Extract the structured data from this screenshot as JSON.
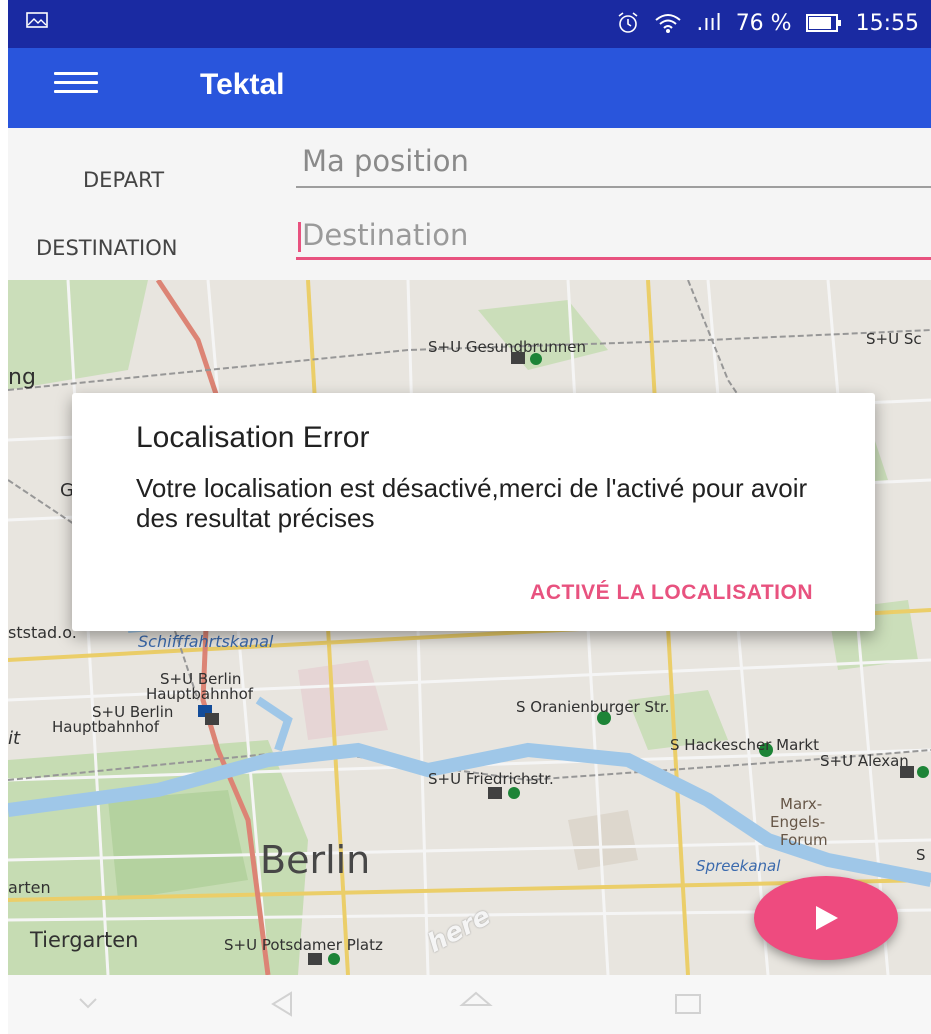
{
  "status_bar": {
    "battery_percent": "76 %",
    "time": "15:55",
    "icons": [
      "image-icon",
      "alarm-icon",
      "wifi-icon",
      "signal-icon",
      "battery-icon"
    ]
  },
  "app_bar": {
    "title": "Tektal",
    "menu_icon": "menu-icon"
  },
  "form": {
    "depart_label": "DEPART",
    "depart_value": "Ma position",
    "destination_label": "DESTINATION",
    "destination_placeholder": "Destination"
  },
  "map": {
    "labels": {
      "gesundbrunnen": "S+U Gesundbrunnen",
      "su_sc": "S+U Sc",
      "ng": "ng",
      "g": "G",
      "ststadion": "ststad.o.",
      "schifffahrtskanal": "Schifffahrtskanal",
      "hbf_top": "S+U Berlin",
      "hbf_top2": "Hauptbahnhof",
      "hbf_left": "S+U Berlin",
      "hbf_left2": "Hauptbahnhof",
      "it": "it",
      "oranienburger": "S Oranienburger Str.",
      "hackescher": "S Hackescher Markt",
      "alexan": "S+U Alexan",
      "friedrichstr": "S+U Friedrichstr.",
      "marx1": "Marx-",
      "marx2": "Engels-",
      "marx3": "Forum",
      "s_right": "S",
      "berlin": "Berlin",
      "spreekanal": "Spreekanal",
      "arten": "arten",
      "tiergarten": "Tiergarten",
      "potsdamer": "S+U Potsdamer Platz",
      "here": "here"
    }
  },
  "dialog": {
    "title": "Localisation Error",
    "message": "Votre localisation est désactivé,merci de l'activé pour avoir des resultat précises",
    "action": "ACTIVÉ LA LOCALISATION"
  },
  "fab": {
    "icon": "play-icon"
  },
  "colors": {
    "status_bar": "#1a2aa2",
    "app_bar": "#2955dc",
    "accent": "#e8527f",
    "fab": "#ee4b7f"
  }
}
